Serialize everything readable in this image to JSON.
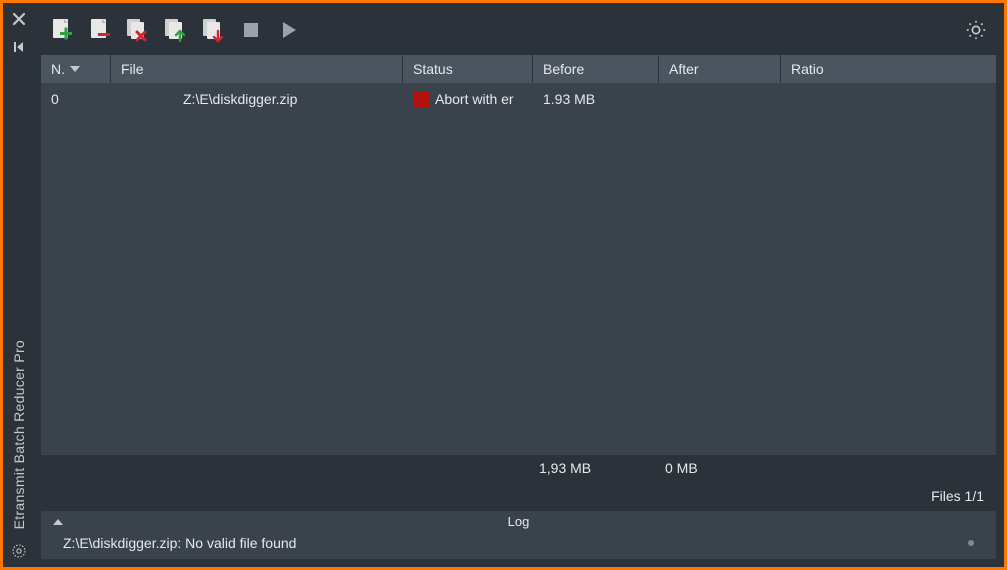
{
  "app": {
    "title": "Etransmit Batch Reducer Pro"
  },
  "toolbar": {
    "buttons": [
      "add-file",
      "remove-file",
      "remove-all",
      "load-list",
      "save-list",
      "stop",
      "play"
    ]
  },
  "columns": {
    "n": "N.",
    "file": "File",
    "status": "Status",
    "before": "Before",
    "after": "After",
    "ratio": "Ratio"
  },
  "rows": [
    {
      "n": "0",
      "file": "Z:\\E\\diskdigger.zip",
      "status": "Abort with er",
      "status_color": "#b31010",
      "before": "1.93 MB",
      "after": "",
      "ratio": ""
    }
  ],
  "totals": {
    "before": "1,93 MB",
    "after": "0 MB"
  },
  "footer": {
    "files_label": "Files 1/1"
  },
  "log": {
    "title": "Log",
    "entry": "Z:\\E\\diskdigger.zip: No valid file found"
  }
}
